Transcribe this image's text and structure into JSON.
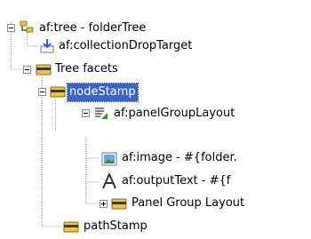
{
  "tree": {
    "nodes": [
      {
        "label": "af:tree - folderTree",
        "icon": "tree-component-icon",
        "expanded": true
      },
      {
        "label": "af:collectionDropTarget",
        "icon": "drop-target-icon"
      },
      {
        "label": "Tree facets",
        "icon": "folder-icon",
        "expanded": true
      },
      {
        "label": "nodeStamp",
        "icon": "folder-icon",
        "expanded": true,
        "selected": true
      },
      {
        "label": "af:panelGroupLayout",
        "icon": "panel-group-layout-icon",
        "expanded": true
      },
      {
        "label": "af:image - #{folder.",
        "icon": "image-icon"
      },
      {
        "label": "af:outputText - #{f",
        "icon": "output-text-icon"
      },
      {
        "label": "Panel Group Layout",
        "icon": "folder-icon",
        "expanded": false
      },
      {
        "label": "pathStamp",
        "icon": "folder-icon"
      }
    ]
  },
  "colors": {
    "selection": "#3665d0",
    "folder": "#e8c54a",
    "connector": "#a0a0a0"
  }
}
